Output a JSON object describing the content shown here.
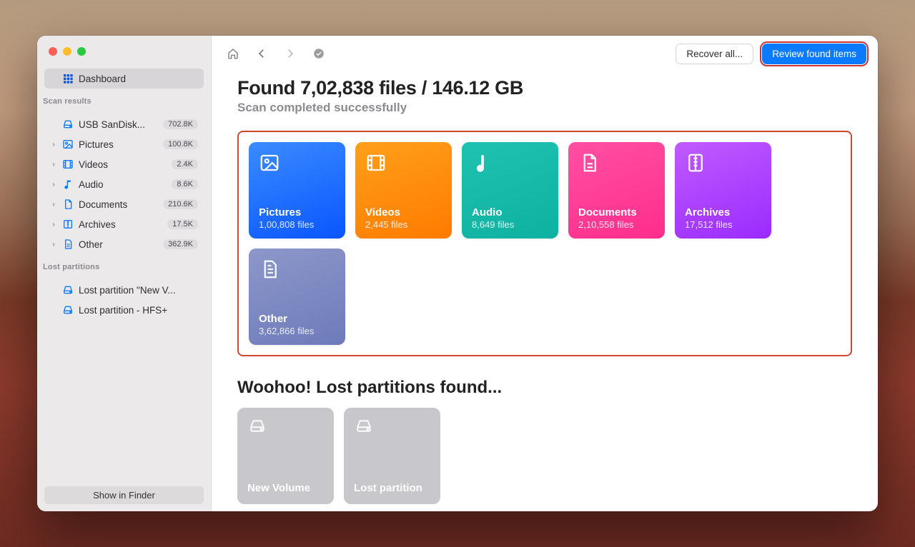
{
  "sidebar": {
    "dashboard_label": "Dashboard",
    "scan_results_header": "Scan results",
    "lost_partitions_header": "Lost partitions",
    "drive": {
      "label": "USB  SanDisk...",
      "count": "702.8K"
    },
    "items": [
      {
        "label": "Pictures",
        "count": "100.8K"
      },
      {
        "label": "Videos",
        "count": "2.4K"
      },
      {
        "label": "Audio",
        "count": "8.6K"
      },
      {
        "label": "Documents",
        "count": "210.6K"
      },
      {
        "label": "Archives",
        "count": "17.5K"
      },
      {
        "label": "Other",
        "count": "362.9K"
      }
    ],
    "partitions": [
      {
        "label": "Lost partition \"New V..."
      },
      {
        "label": "Lost partition - HFS+"
      }
    ],
    "show_in_finder": "Show in Finder"
  },
  "toolbar": {
    "recover_all": "Recover all...",
    "review": "Review found items"
  },
  "summary": {
    "title": "Found 7,02,838 files / 146.12 GB",
    "subtitle": "Scan completed successfully"
  },
  "cards": [
    {
      "title": "Pictures",
      "meta": "1,00,808 files"
    },
    {
      "title": "Videos",
      "meta": "2,445 files"
    },
    {
      "title": "Audio",
      "meta": "8,649 files"
    },
    {
      "title": "Documents",
      "meta": "2,10,558 files"
    },
    {
      "title": "Archives",
      "meta": "17,512 files"
    },
    {
      "title": "Other",
      "meta": "3,62,866 files"
    }
  ],
  "partitions_section": {
    "title": "Woohoo! Lost partitions found...",
    "cards": [
      {
        "title": "New Volume"
      },
      {
        "title": "Lost partition"
      }
    ]
  }
}
